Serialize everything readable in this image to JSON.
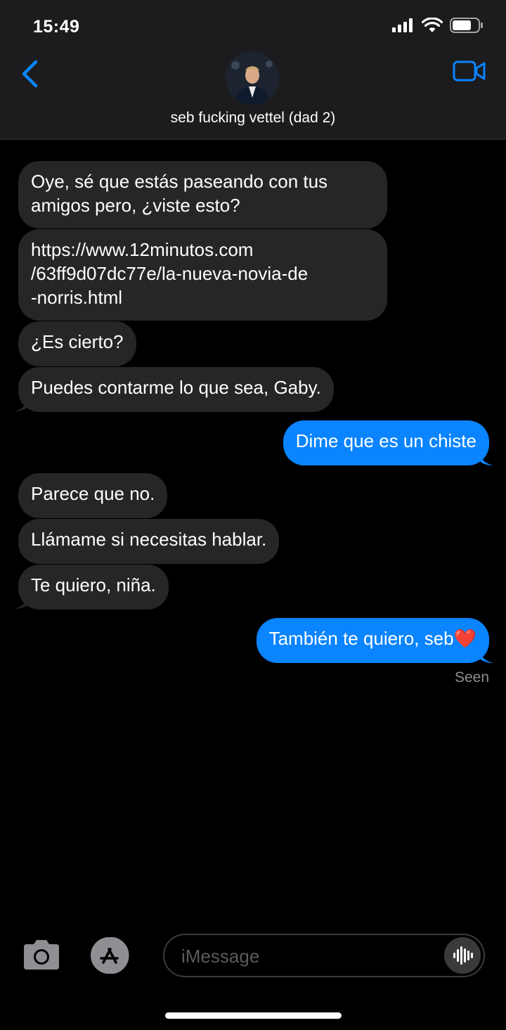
{
  "status_bar": {
    "time": "15:49"
  },
  "header": {
    "contact_name": "seb fucking vettel (dad 2)"
  },
  "messages": [
    {
      "dir": "in",
      "text": "Oye, sé que estás paseando con tus amigos pero, ¿viste esto?"
    },
    {
      "dir": "in",
      "text": "https://www.12minutos.com/63ff9d07dc77e/la-nueva-novia-de-norris.html"
    },
    {
      "dir": "in",
      "text": "¿Es cierto?"
    },
    {
      "dir": "in",
      "text": "Puedes contarme lo que sea, Gaby."
    },
    {
      "dir": "out",
      "text": "Dime que es un chiste"
    },
    {
      "dir": "in",
      "text": "Parece que no."
    },
    {
      "dir": "in",
      "text": "Llámame si necesitas hablar."
    },
    {
      "dir": "in",
      "text": "Te quiero, niña."
    },
    {
      "dir": "out",
      "text": "También te quiero, seb❤️"
    }
  ],
  "message_lines": {
    "m0": [
      "Oye, sé que estás paseando con tus",
      "amigos pero, ¿viste esto?"
    ],
    "m1": [
      "https://www.12minutos.com",
      "/63ff9d07dc77e/la-nueva-novia-de",
      "-norris.html"
    ]
  },
  "read_receipt": "Seen",
  "composer": {
    "placeholder": "iMessage"
  },
  "icons": [
    "back-chevron-icon",
    "video-camera-icon",
    "camera-icon",
    "app-store-icon",
    "audio-waveform-icon",
    "signal-icon",
    "wifi-icon",
    "battery-icon"
  ],
  "colors": {
    "accent": "#0a84ff",
    "incoming_bubble": "#262628",
    "header_bg": "#1c1c1e"
  }
}
